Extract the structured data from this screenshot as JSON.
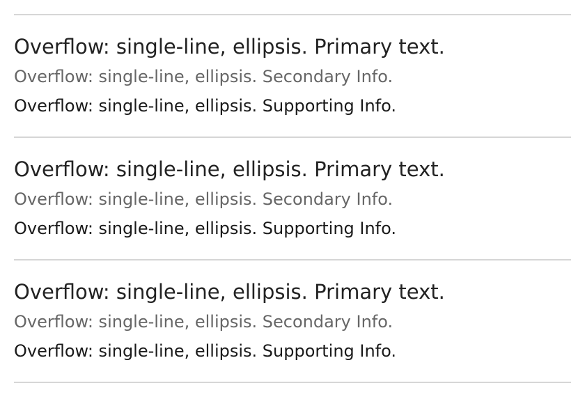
{
  "list": {
    "items": [
      {
        "primary": "Overflow: single-line, ellipsis. Primary text.",
        "secondary": "Overflow: single-line, ellipsis. Secondary Info.",
        "supporting": "Overflow: single-line, ellipsis. Supporting Info."
      },
      {
        "primary": "Overflow: single-line, ellipsis. Primary text.",
        "secondary": "Overflow: single-line, ellipsis. Secondary Info.",
        "supporting": "Overflow: single-line, ellipsis. Supporting Info."
      },
      {
        "primary": "Overflow: single-line, ellipsis. Primary text.",
        "secondary": "Overflow: single-line, ellipsis. Secondary Info.",
        "supporting": "Overflow: single-line, ellipsis. Supporting Info."
      }
    ]
  },
  "colors": {
    "primary_text": "#222222",
    "secondary_text": "#666666",
    "supporting_text": "#1a1a1a",
    "divider": "#d6d6d6"
  }
}
